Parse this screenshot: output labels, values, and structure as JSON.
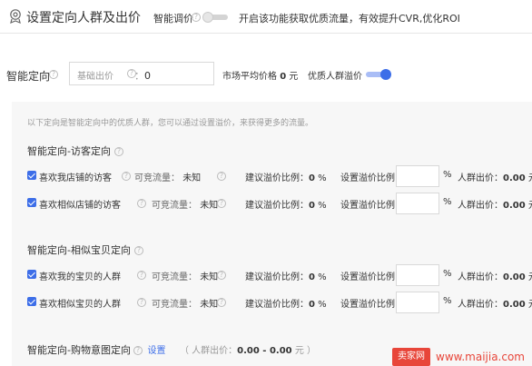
{
  "header": {
    "title": "设置定向人群及出价",
    "smart_bid_label": "智能调价",
    "smart_bid_on": false,
    "smart_bid_desc": "开启该功能获取优质流量，有效提升CVR,优化ROI"
  },
  "smart_targeting": {
    "label": "智能定向",
    "base_bid_label": "基础出价",
    "base_bid_colon": "：",
    "base_bid_value": "0",
    "market_avg_label": "市场平均价格",
    "market_avg_value": "0",
    "market_avg_unit": "元",
    "premium_label": "优质人群溢价",
    "premium_on": true
  },
  "panel": {
    "notice": "以下定向是智能定向中的优质人群，您可以通过设置溢价，来获得更多的流量。",
    "groups": [
      {
        "title": "智能定向-访客定向",
        "rows": [
          {
            "name": "喜欢我店铺的访客",
            "traffic_label": "可竞流量：",
            "traffic_value": "未知",
            "suggest_label": "建议溢价比例：",
            "suggest_value": "0",
            "suggest_unit": "%",
            "set_label": "设置溢价比例",
            "ratio_value": "",
            "pct": "%",
            "bid_label": "人群出价：",
            "bid_value": "0.00",
            "bid_unit": "元",
            "checked": true
          },
          {
            "name": "喜欢相似店铺的访客",
            "traffic_label": "可竞流量：",
            "traffic_value": "未知",
            "suggest_label": "建议溢价比例：",
            "suggest_value": "0",
            "suggest_unit": "%",
            "set_label": "设置溢价比例",
            "ratio_value": "",
            "pct": "%",
            "bid_label": "人群出价：",
            "bid_value": "0.00",
            "bid_unit": "元",
            "checked": true
          }
        ]
      },
      {
        "title": "智能定向-相似宝贝定向",
        "rows": [
          {
            "name": "喜欢我的宝贝的人群",
            "traffic_label": "可竞流量：",
            "traffic_value": "未知",
            "suggest_label": "建议溢价比例：",
            "suggest_value": "0",
            "suggest_unit": "%",
            "set_label": "设置溢价比例",
            "ratio_value": "",
            "pct": "%",
            "bid_label": "人群出价：",
            "bid_value": "0.00",
            "bid_unit": "元",
            "checked": true
          },
          {
            "name": "喜欢相似宝贝的人群",
            "traffic_label": "可竞流量：",
            "traffic_value": "未知",
            "suggest_label": "建议溢价比例：",
            "suggest_value": "0",
            "suggest_unit": "%",
            "set_label": "设置溢价比例",
            "ratio_value": "",
            "pct": "%",
            "bid_label": "人群出价：",
            "bid_value": "0.00",
            "bid_unit": "元",
            "checked": true
          }
        ]
      }
    ],
    "intent": {
      "title": "智能定向-购物意图定向",
      "set_link": "设置",
      "range_label": "（ 人群出价：",
      "range_value": "0.00 - 0.00",
      "range_unit": "元 ）"
    }
  },
  "watermark": {
    "badge": "卖家网",
    "url": "www.maijia.com"
  },
  "colors": {
    "accent": "#3d6ee8",
    "watermark": "#e8463a"
  }
}
